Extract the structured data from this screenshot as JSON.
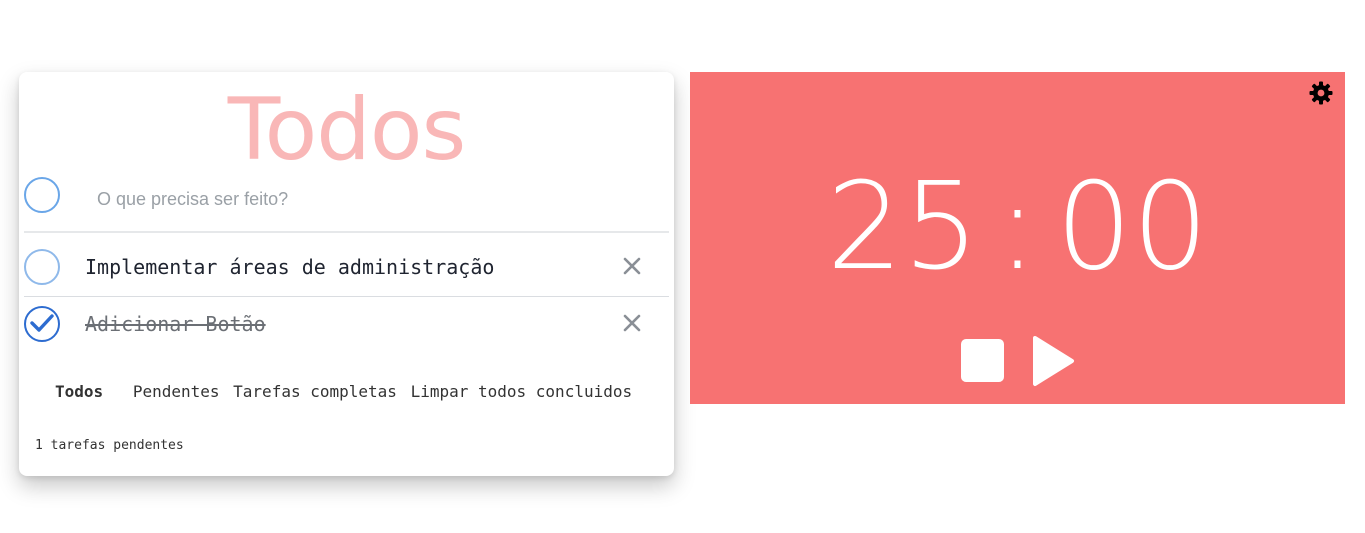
{
  "todo": {
    "title": "Todos",
    "new_todo_placeholder": "O que precisa ser feito?",
    "new_todo_value": "",
    "items": [
      {
        "text": "Implementar áreas de administração",
        "completed": false
      },
      {
        "text": "Adicionar Botão",
        "completed": true
      }
    ],
    "filters": {
      "all": "Todos",
      "pending": "Pendentes",
      "completed": "Tarefas completas",
      "clear": "Limpar todos concluidos"
    },
    "pending_count": "1 tarefas pendentes"
  },
  "timer": {
    "minutes": "25",
    "separator": ":",
    "seconds": "00",
    "icons": {
      "settings": "gear-icon",
      "stop": "stop-icon",
      "play": "play-icon"
    },
    "background_color": "#f77272"
  },
  "colors": {
    "title_color": "#f9b7b7",
    "check_color": "#2d6cd0"
  }
}
